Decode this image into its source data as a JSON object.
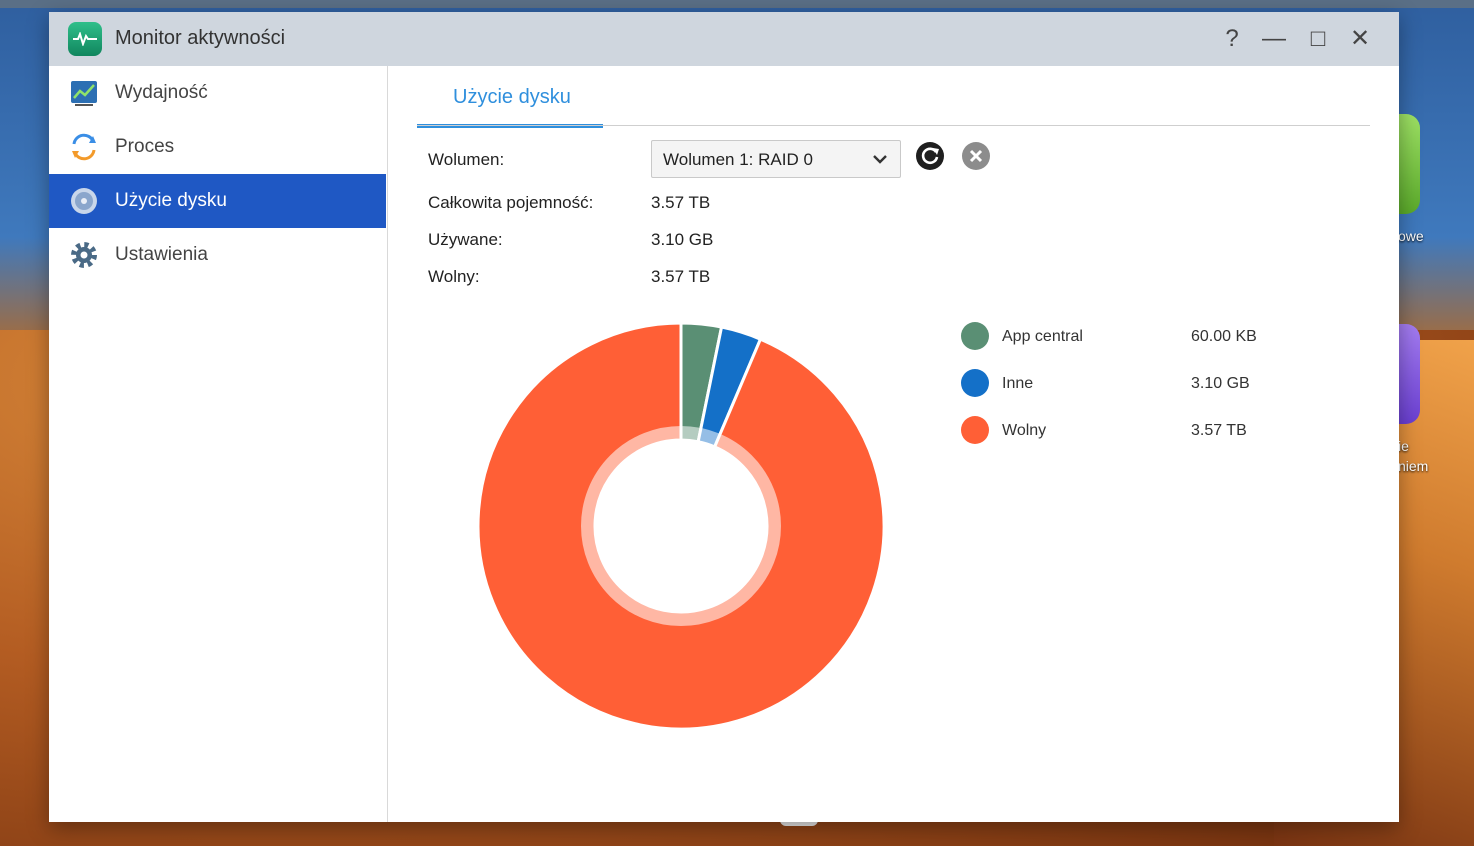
{
  "window": {
    "title": "Monitor aktywności"
  },
  "titlebar": {
    "help": "?",
    "minimize": "—",
    "maximize": "□",
    "close": "✕"
  },
  "sidebar": {
    "items": [
      {
        "label": "Wydajność",
        "icon": "performance-chart-icon"
      },
      {
        "label": "Proces",
        "icon": "process-icon"
      },
      {
        "label": "Użycie dysku",
        "icon": "disk-usage-icon",
        "active": true
      },
      {
        "label": "Ustawienia",
        "icon": "gear-icon"
      }
    ]
  },
  "tabs": [
    {
      "label": "Użycie dysku"
    }
  ],
  "volume": {
    "label": "Wolumen:",
    "selected": "Wolumen 1: RAID 0"
  },
  "info": {
    "total_label": "Całkowita pojemność:",
    "total_value": "3.57 TB",
    "used_label": "Używane:",
    "used_value": "3.10 GB",
    "free_label": "Wolny:",
    "free_value": "3.57 TB"
  },
  "chart_data": {
    "type": "pie",
    "variant": "donut",
    "series": [
      {
        "name": "App central",
        "value_label": "60.00 KB",
        "share": 0.032,
        "color": "#5a8f74"
      },
      {
        "name": "Inne",
        "value_label": "3.10 GB",
        "share": 0.032,
        "color": "#1470c8"
      },
      {
        "name": "Wolny",
        "value_label": "3.57 TB",
        "share": 0.936,
        "color": "#ff5f36"
      }
    ]
  },
  "desktop": {
    "labels": [
      "owe",
      "ie",
      "niem"
    ]
  }
}
